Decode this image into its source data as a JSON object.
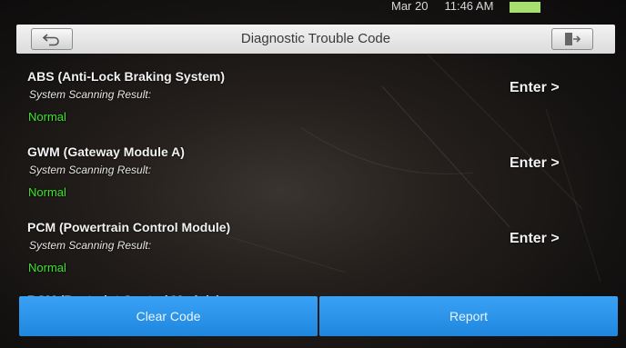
{
  "status_bar": {
    "date": "Mar 20",
    "time": "11:46 AM"
  },
  "header": {
    "title": "Diagnostic Trouble Code",
    "back_icon": "back-arrow-icon",
    "exit_icon": "exit-icon"
  },
  "systems": [
    {
      "name": "ABS (Anti-Lock Braking System)",
      "scan_label": "System Scanning Result:",
      "result": "Normal",
      "enter_label": "Enter >"
    },
    {
      "name": "GWM (Gateway Module A)",
      "scan_label": "System Scanning Result:",
      "result": "Normal",
      "enter_label": "Enter >"
    },
    {
      "name": "PCM (Powertrain Control Module)",
      "scan_label": "System Scanning Result:",
      "result": "Normal",
      "enter_label": "Enter >"
    }
  ],
  "partial_item": {
    "name": "RCM (Restraint Control Module)"
  },
  "footer": {
    "clear_label": "Clear Code",
    "report_label": "Report"
  },
  "colors": {
    "header_bg": "#e6e6e6",
    "result_green": "#3ee32c",
    "footer_blue": "#2a93ea"
  }
}
